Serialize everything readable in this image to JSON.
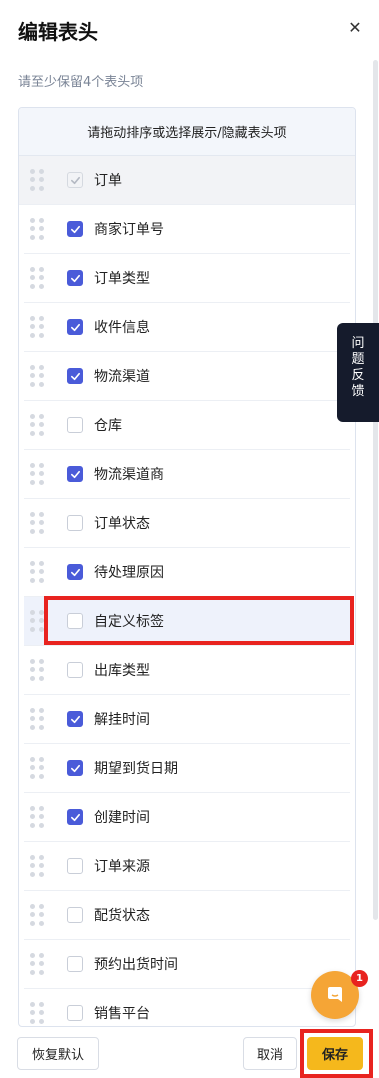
{
  "header": {
    "title": "编辑表头",
    "close_icon": "close-icon"
  },
  "hint": "请至少保留4个表头项",
  "panel": {
    "heading": "请拖动排序或选择展示/隐藏表头项",
    "rows": [
      {
        "label": "订单",
        "checked": true,
        "disabled": true
      },
      {
        "label": "商家订单号",
        "checked": true
      },
      {
        "label": "订单类型",
        "checked": true
      },
      {
        "label": "收件信息",
        "checked": true
      },
      {
        "label": "物流渠道",
        "checked": true
      },
      {
        "label": "仓库",
        "checked": false
      },
      {
        "label": "物流渠道商",
        "checked": true
      },
      {
        "label": "订单状态",
        "checked": false
      },
      {
        "label": "待处理原因",
        "checked": true
      },
      {
        "label": "自定义标签",
        "checked": false,
        "highlighted": true
      },
      {
        "label": "出库类型",
        "checked": false
      },
      {
        "label": "解挂时间",
        "checked": true
      },
      {
        "label": "期望到货日期",
        "checked": true
      },
      {
        "label": "创建时间",
        "checked": true
      },
      {
        "label": "订单来源",
        "checked": false
      },
      {
        "label": "配货状态",
        "checked": false
      },
      {
        "label": "预约出货时间",
        "checked": false
      },
      {
        "label": "销售平台",
        "checked": false
      }
    ]
  },
  "feedback": {
    "chars": [
      "问",
      "题",
      "反",
      "馈"
    ]
  },
  "footer": {
    "reset_label": "恢复默认",
    "cancel_label": "取消",
    "save_label": "保存"
  },
  "chat": {
    "badge": "1",
    "icon": "chat-icon"
  },
  "colors": {
    "accent": "#4a5bd9",
    "save": "#f5b81c",
    "highlight": "#e8231f",
    "chat": "#f5a536"
  }
}
